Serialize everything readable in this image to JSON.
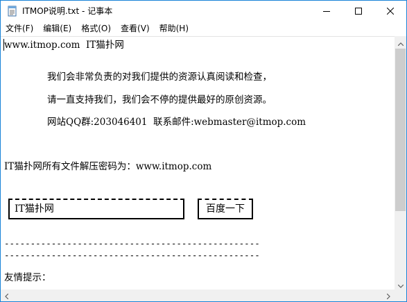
{
  "window": {
    "title": "ITMOP说明.txt - 记事本",
    "icon": "notepad-icon",
    "border_color": "#1883d7"
  },
  "menu": {
    "items": [
      {
        "label": "文件(F)"
      },
      {
        "label": "编辑(E)"
      },
      {
        "label": "格式(O)"
      },
      {
        "label": "查看(V)"
      },
      {
        "label": "帮助(H)"
      }
    ]
  },
  "content": {
    "line1": "www.itmop.com  IT猫扑网",
    "line2": "我们会非常负责的对我们提供的资源认真阅读和检查，",
    "line3": "请一直支持我们，我们会不停的提供最好的原创资源。",
    "line4": "网站QQ群:203046401  联系邮件:webmaster@itmop.com",
    "line5": "IT猫扑网所有文件解压密码为：www.itmop.com",
    "search_box_text": "IT猫扑网",
    "search_button_text": "百度一下",
    "dashes1": "-------------------------------------------------",
    "dashes2": "-------------------------------------------------",
    "line6": "友情提示："
  },
  "icons": {
    "minimize": "minimize-icon",
    "maximize": "maximize-icon",
    "close": "close-icon"
  }
}
